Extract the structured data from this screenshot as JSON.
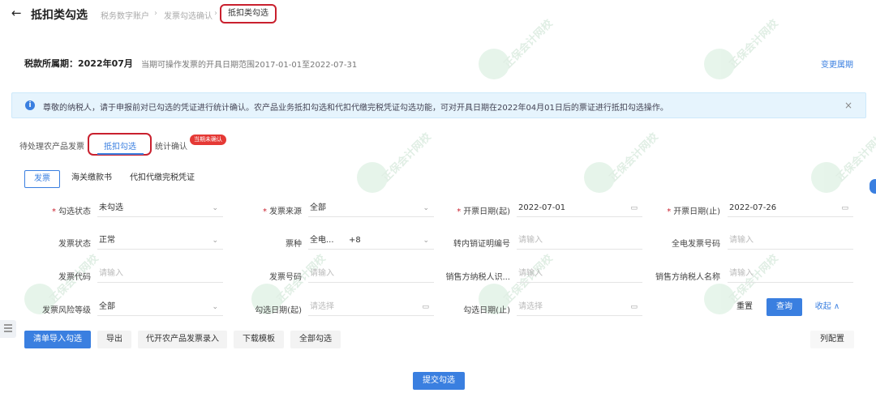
{
  "header": {
    "title": "抵扣类勾选",
    "breadcrumbs": [
      "税务数字账户",
      "发票勾选确认",
      "抵扣类勾选"
    ]
  },
  "period": {
    "label": "税款所属期：2022年07月",
    "range": "当期可操作发票的开具日期范围2017-01-01至2022-07-31",
    "change_link": "变更属期"
  },
  "notice": {
    "text": "尊敬的纳税人，请于申报前对已勾选的凭证进行统计确认。农产品业务抵扣勾选和代扣代缴完税凭证勾选功能，可对开具日期在2022年04月01日后的票证进行抵扣勾选操作。",
    "close": "×"
  },
  "tabs": {
    "pending": "待处理农产品发票",
    "active": "抵扣勾选",
    "stat": "统计确认",
    "badge": "当期未确认"
  },
  "subtabs": [
    "发票",
    "海关缴款书",
    "代扣代缴完税凭证"
  ],
  "form": {
    "select_status": {
      "label": "勾选状态",
      "value": "未勾选"
    },
    "invoice_source": {
      "label": "发票来源",
      "value": "全部"
    },
    "date_start": {
      "label": "开票日期(起)",
      "value": "2022-07-01"
    },
    "date_end": {
      "label": "开票日期(止)",
      "value": "2022-07-26"
    },
    "invoice_status": {
      "label": "发票状态",
      "value": "正常"
    },
    "invoice_type": {
      "label": "票种",
      "value": "全电...",
      "extra": "+8"
    },
    "transfer_cert": {
      "label": "转内销证明编号",
      "placeholder": "请输入"
    },
    "full_elec_no": {
      "label": "全电发票号码",
      "placeholder": "请输入"
    },
    "invoice_code": {
      "label": "发票代码",
      "placeholder": "请输入"
    },
    "invoice_no": {
      "label": "发票号码",
      "placeholder": "请输入"
    },
    "seller_tax_id": {
      "label": "销售方纳税人识...",
      "placeholder": "请输入"
    },
    "seller_name": {
      "label": "销售方纳税人名称",
      "placeholder": "请输入"
    },
    "risk_level": {
      "label": "发票风险等级",
      "value": "全部"
    },
    "select_date_start": {
      "label": "勾选日期(起)",
      "placeholder": "请选择"
    },
    "select_date_end": {
      "label": "勾选日期(止)",
      "placeholder": "请选择"
    }
  },
  "buttons": {
    "reset": "重置",
    "query": "查询",
    "collapse": "收起 ∧",
    "import": "清单导入勾选",
    "export": "导出",
    "agri_entry": "代开农产品发票录入",
    "download_template": "下载模板",
    "select_all": "全部勾选",
    "column_config": "列配置",
    "submit": "提交勾选"
  },
  "icons": {
    "back": "←",
    "chevron": "⌄",
    "calendar": "▭",
    "info": "i"
  },
  "watermark": "正保会计网校",
  "colors": {
    "primary": "#3a7fe0",
    "highlight": "#c9202e",
    "badge": "#e53935",
    "notice_bg": "#e6f4fd"
  }
}
